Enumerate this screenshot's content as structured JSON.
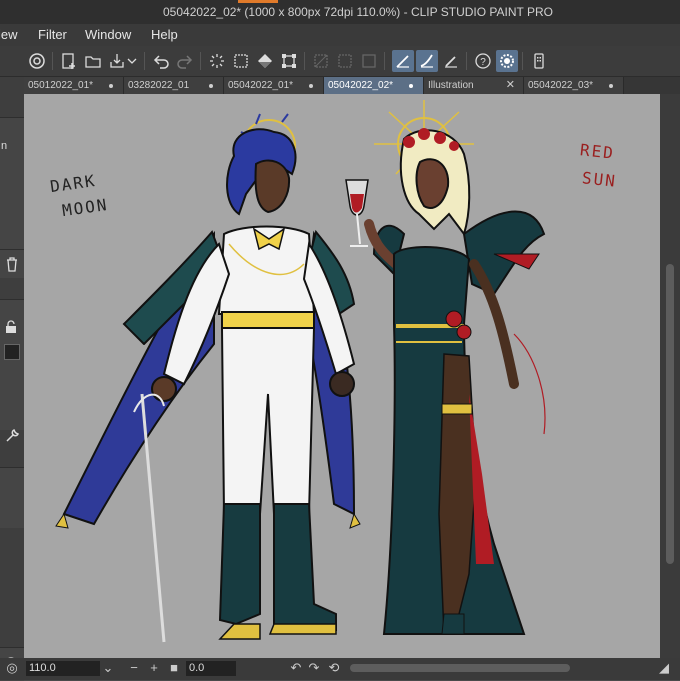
{
  "window": {
    "title": "05042022_02* (1000 x 800px 72dpi 110.0%)  - CLIP STUDIO PAINT PRO"
  },
  "menu": [
    "iew",
    "Filter",
    "Window",
    "Help"
  ],
  "left_panel": {
    "partial_label": "n"
  },
  "tabs": [
    {
      "label": "05012022_01*",
      "active": false,
      "marker": "dot"
    },
    {
      "label": "03282022_01",
      "active": false,
      "marker": "dot"
    },
    {
      "label": "05042022_01*",
      "active": false,
      "marker": "dot"
    },
    {
      "label": "05042022_02*",
      "active": true,
      "marker": "dot"
    },
    {
      "label": "Illustration",
      "active": false,
      "marker": "x"
    },
    {
      "label": "05042022_03*",
      "active": false,
      "marker": "dot"
    }
  ],
  "canvas": {
    "left_text": [
      "DARK",
      "MOON"
    ],
    "right_text": [
      "RED",
      "SUN"
    ],
    "background_color": "#a6a6a6"
  },
  "status": {
    "zoom": "110.0",
    "rotation": "0.0"
  },
  "colors": {
    "accent_active_tab": "#5c6f86",
    "title_accent": "#e07a2a"
  }
}
